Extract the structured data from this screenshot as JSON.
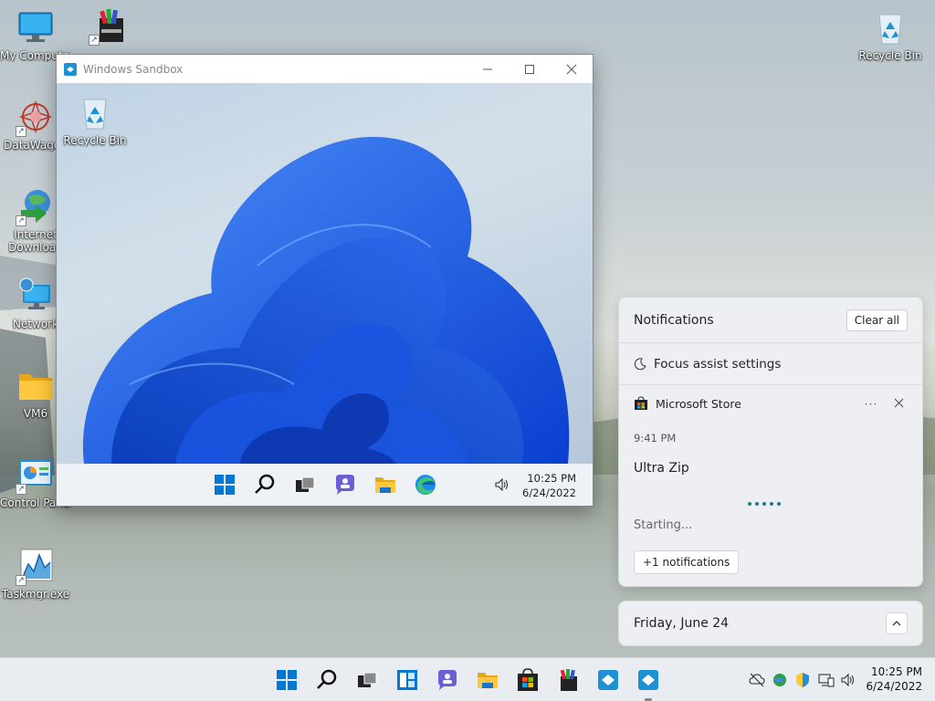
{
  "desktop": {
    "icons": [
      {
        "label": "My Computer",
        "icon": "computer-icon"
      },
      {
        "label": "",
        "icon": "archive-tool-icon"
      },
      {
        "label": "DataWagon",
        "icon": "datawagon-icon"
      },
      {
        "label": "Internet Download",
        "icon": "internet-download-icon"
      },
      {
        "label": "Network",
        "icon": "network-icon"
      },
      {
        "label": "VM6",
        "icon": "folder-icon"
      },
      {
        "label": "Control Panel",
        "icon": "control-panel-icon"
      },
      {
        "label": "Taskmgr.exe",
        "icon": "task-manager-icon"
      },
      {
        "label": "Recycle Bin",
        "icon": "recycle-bin-icon"
      }
    ]
  },
  "sandbox": {
    "title": "Windows Sandbox",
    "desktop_icon": "Recycle Bin",
    "clock_time": "10:25 PM",
    "clock_date": "6/24/2022"
  },
  "notifications": {
    "header": "Notifications",
    "clear_all": "Clear all",
    "focus_assist": "Focus assist settings",
    "card": {
      "app": "Microsoft Store",
      "more": "···",
      "time": "9:41 PM",
      "title": "Ultra Zip",
      "status": "Starting...",
      "more_button": "+1 notifications"
    }
  },
  "calendar": {
    "date": "Friday, June 24"
  },
  "taskbar": {
    "clock_time": "10:25 PM",
    "clock_date": "6/24/2022"
  },
  "colors": {
    "accent": "#0067c0",
    "progress": "#1f7a8c"
  }
}
